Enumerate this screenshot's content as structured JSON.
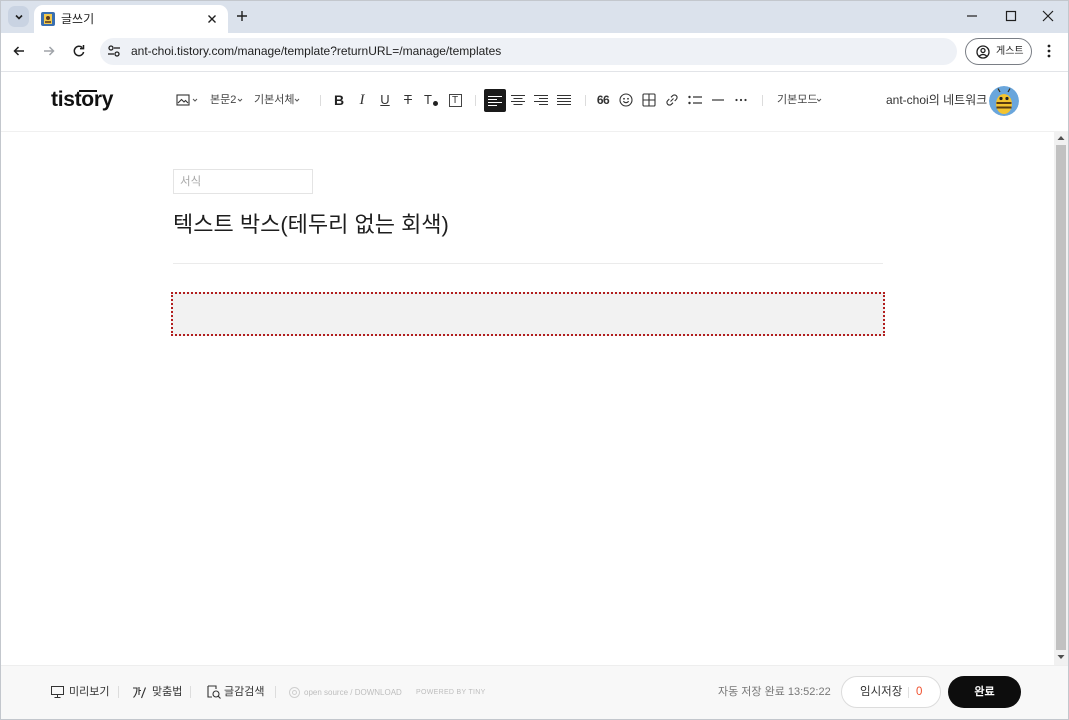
{
  "browser": {
    "tab_title": "글쓰기",
    "url": "ant-choi.tistory.com/manage/template?returnURL=/manage/templates",
    "profile_label": "게스트"
  },
  "editor": {
    "logo": "tistory",
    "toolbar": {
      "paragraph_style": "본문2",
      "font_family": "기본서체",
      "bold": "B",
      "italic": "I",
      "underline": "U",
      "strikethrough": "T",
      "text_color": "T",
      "background_color": "T",
      "quote": "66",
      "editor_mode": "기본모드"
    },
    "blog_name": "ant-choi의 네트워크",
    "template_name": {
      "value": "",
      "placeholder": "서식"
    },
    "post_title": "텍스트 박스(테두리 없는 회색)"
  },
  "footer": {
    "preview": "미리보기",
    "spellcheck": "맞춤법",
    "content_search": "글감검색",
    "open_source": "open source / DOWNLOAD",
    "powered_by": "POWERED BY TINY",
    "autosave_status": "자동 저장 완료 13:52:22",
    "temp_save_label": "임시저장",
    "temp_save_count": "0",
    "publish_label": "완료"
  },
  "colors": {
    "tab_strip": "#dbe2ec",
    "url_bar": "#eef1f6",
    "active_tool": "#1a1a1a",
    "publish_button": "#0d0d0d",
    "temp_save_count": "#f0502d",
    "text_box_background": "#f2f2f2",
    "text_box_border": "#b21e1e"
  },
  "icons": {
    "browser": [
      "tab-search-icon",
      "favicon-icon",
      "tab-close-icon",
      "new-tab-icon",
      "minimize-icon",
      "maximize-icon",
      "window-close-icon",
      "back-icon",
      "forward-icon",
      "reload-icon",
      "site-info-icon",
      "profile-icon",
      "menu-icon"
    ],
    "toolbar": [
      "image-icon",
      "align-left-icon",
      "align-center-icon",
      "align-right-icon",
      "align-justify-icon",
      "emoji-icon",
      "table-icon",
      "link-icon",
      "bullet-list-icon",
      "horizontal-rule-icon",
      "more-icon"
    ],
    "footer": [
      "monitor-icon",
      "spellcheck-icon",
      "search-document-icon",
      "open-source-icon"
    ]
  }
}
